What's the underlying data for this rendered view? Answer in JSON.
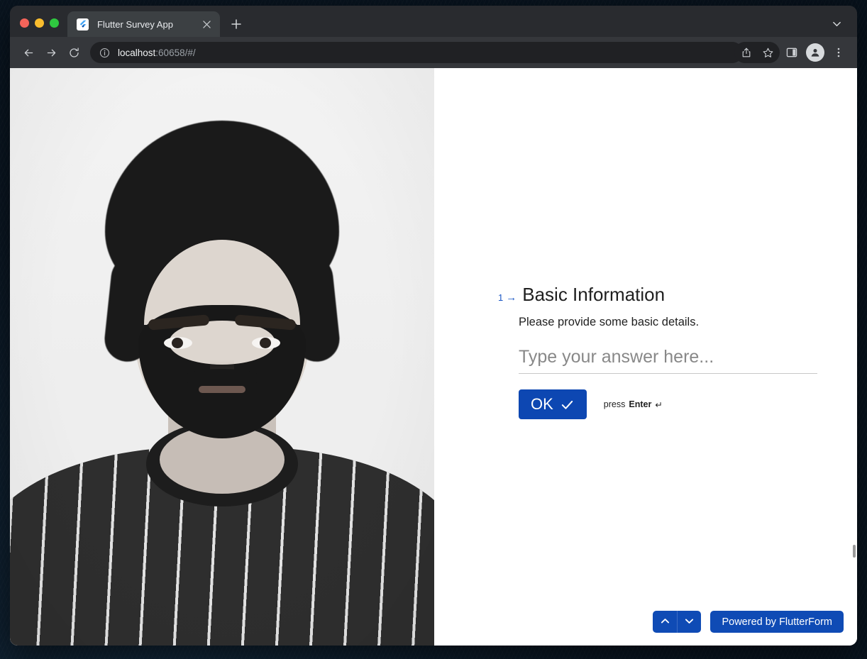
{
  "window": {
    "traffic_lights": [
      "close",
      "minimize",
      "maximize"
    ]
  },
  "browser": {
    "tabs": [
      {
        "title": "Flutter Survey App",
        "favicon": "flutter-logo-icon",
        "close_label": "×",
        "active": true
      }
    ],
    "new_tab_label": "+",
    "tab_search_icon": "chevron-down-icon",
    "toolbar": {
      "back_icon": "arrow-left-icon",
      "forward_icon": "arrow-right-icon",
      "reload_icon": "reload-icon",
      "site_info_icon": "info-circle-icon",
      "url_host": "localhost",
      "url_rest": ":60658/#/",
      "url_full": "localhost:60658/#/",
      "share_icon": "share-icon",
      "bookmark_icon": "star-icon",
      "side_panel_icon": "side-panel-icon",
      "profile_icon": "person-avatar-icon",
      "menu_icon": "three-dot-menu-icon"
    }
  },
  "page": {
    "hero_image": {
      "alt": "black-and-white portrait of a bearded man with curly hair wearing a striped t-shirt"
    },
    "question": {
      "number": "1",
      "arrow": "→",
      "title": "Basic Information",
      "description": "Please provide some basic details.",
      "answer_value": "",
      "answer_placeholder": "Type your answer here...",
      "ok_label": "OK",
      "ok_icon": "check-icon",
      "hint_prefix": "press",
      "hint_key": "Enter",
      "hint_symbol": "↵"
    },
    "bottom_controls": {
      "scroll_up_icon": "chevron-up-icon",
      "scroll_down_icon": "chevron-down-icon",
      "powered_by_label": "Powered by FlutterForm"
    }
  },
  "colors": {
    "brand_blue": "#0d47b2",
    "accent_blue": "#0f4bb5",
    "link_blue": "#1a56c4",
    "tab_bar": "#292b2f",
    "toolbar": "#35373b",
    "omnibox": "#202124",
    "text_dark": "#1f1f1f",
    "desktop": "#0c1824"
  }
}
